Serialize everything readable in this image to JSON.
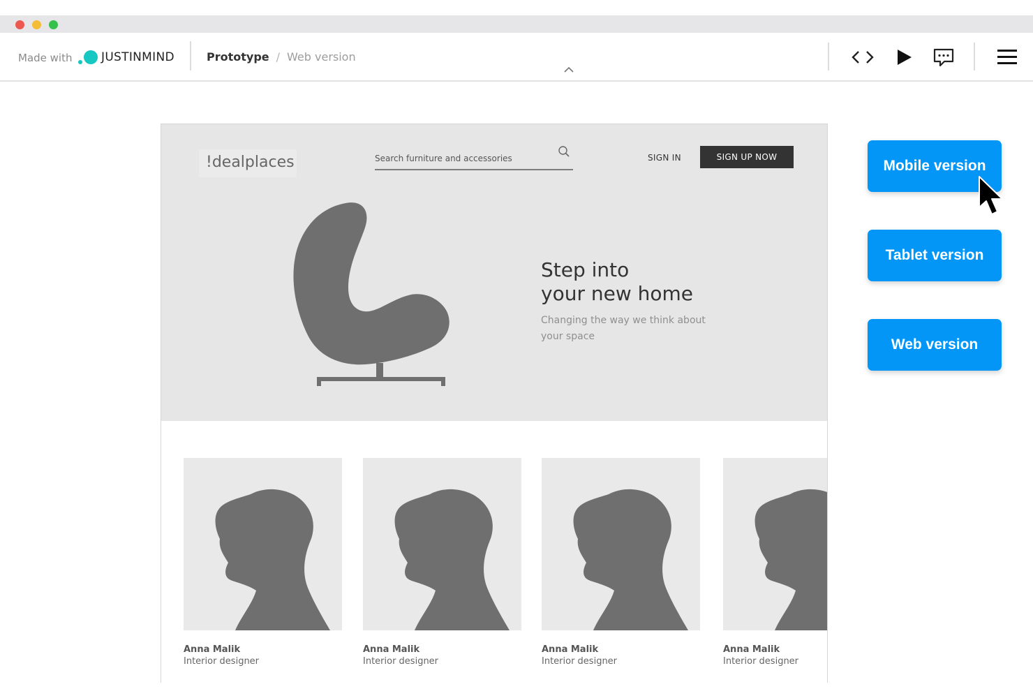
{
  "window": {
    "controls": [
      "close",
      "minimize",
      "maximize"
    ],
    "colors": {
      "close": "#ed594f",
      "minimize": "#f5bd37",
      "maximize": "#35c14a"
    }
  },
  "toolbar": {
    "made_with": "Made with",
    "brand": "JUSTINMIND",
    "brand_color": "#16c7c2",
    "breadcrumb": {
      "current": "Prototype",
      "separator": "/",
      "page": "Web version"
    },
    "icons": [
      "code-icon",
      "play-icon",
      "comment-icon",
      "menu-icon"
    ]
  },
  "prototype": {
    "logo": "!dealplaces",
    "search_placeholder": "Search furniture and accessories",
    "sign_in": "SIGN IN",
    "sign_up": "SIGN UP NOW",
    "hero": {
      "title_line1": "Step into",
      "title_line2": "your new home",
      "subtitle": "Changing the way we think about your space"
    },
    "team": [
      {
        "name": "Anna Malik",
        "role": "Interior designer"
      },
      {
        "name": "Anna Malik",
        "role": "Interior designer"
      },
      {
        "name": "Anna Malik",
        "role": "Interior designer"
      },
      {
        "name": "Anna Malik",
        "role": "Interior designer"
      }
    ]
  },
  "versions": {
    "mobile": "Mobile version",
    "tablet": "Tablet version",
    "web": "Web version",
    "button_color": "#0396f6"
  }
}
